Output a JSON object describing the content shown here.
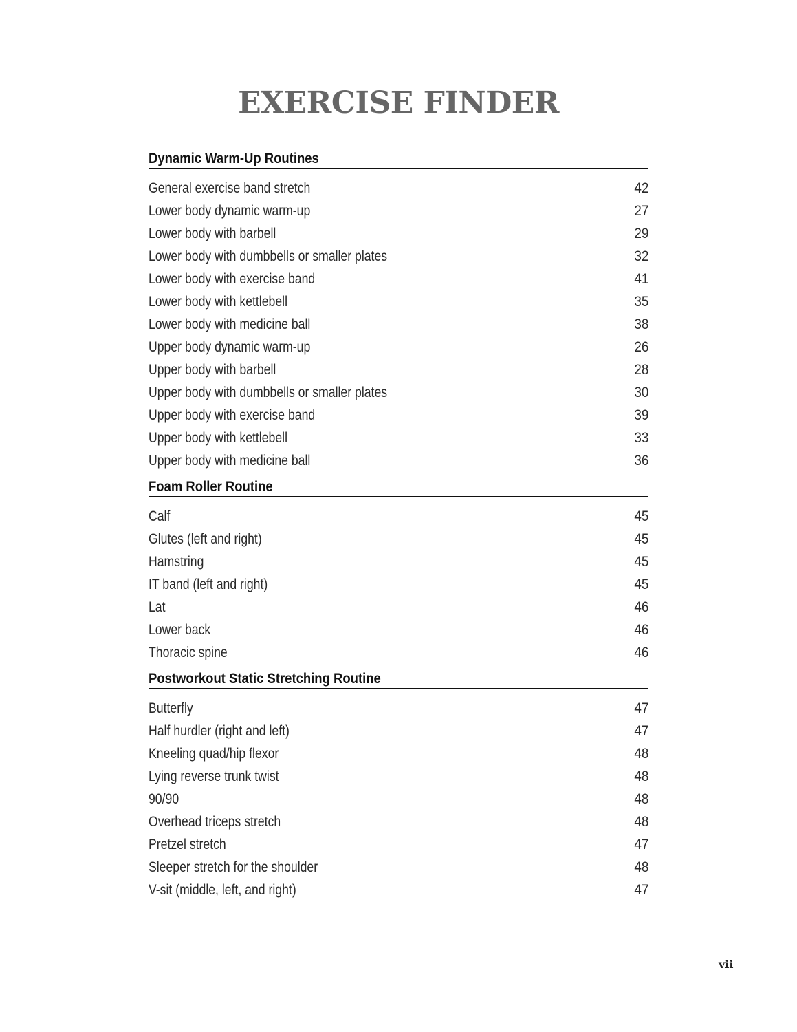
{
  "title": "EXERCISE FINDER",
  "page_number": "vii",
  "sections": [
    {
      "heading": "Dynamic Warm-Up Routines",
      "entries": [
        {
          "name": "General exercise band stretch",
          "page": "42"
        },
        {
          "name": "Lower body dynamic warm-up",
          "page": "27"
        },
        {
          "name": "Lower body with barbell",
          "page": "29"
        },
        {
          "name": "Lower body with dumbbells or smaller plates",
          "page": "32"
        },
        {
          "name": "Lower body with exercise band",
          "page": "41"
        },
        {
          "name": "Lower body with kettlebell",
          "page": "35"
        },
        {
          "name": "Lower body with medicine ball",
          "page": "38"
        },
        {
          "name": "Upper body dynamic warm-up",
          "page": "26"
        },
        {
          "name": "Upper body with barbell",
          "page": "28"
        },
        {
          "name": "Upper body with dumbbells or smaller plates",
          "page": "30"
        },
        {
          "name": "Upper body with exercise band",
          "page": "39"
        },
        {
          "name": "Upper body with kettlebell",
          "page": "33"
        },
        {
          "name": "Upper body with medicine ball",
          "page": "36"
        }
      ]
    },
    {
      "heading": "Foam Roller Routine",
      "entries": [
        {
          "name": "Calf",
          "page": "45"
        },
        {
          "name": "Glutes (left and right)",
          "page": "45"
        },
        {
          "name": "Hamstring",
          "page": "45"
        },
        {
          "name": "IT band (left and right)",
          "page": "45"
        },
        {
          "name": "Lat",
          "page": "46"
        },
        {
          "name": "Lower back",
          "page": "46"
        },
        {
          "name": "Thoracic spine",
          "page": "46"
        }
      ]
    },
    {
      "heading": "Postworkout Static Stretching Routine",
      "entries": [
        {
          "name": "Butterfly",
          "page": "47"
        },
        {
          "name": "Half hurdler (right and left)",
          "page": "47"
        },
        {
          "name": "Kneeling quad/hip flexor",
          "page": "48"
        },
        {
          "name": "Lying reverse trunk twist",
          "page": "48"
        },
        {
          "name": "90/90",
          "page": "48"
        },
        {
          "name": "Overhead triceps stretch",
          "page": "48"
        },
        {
          "name": "Pretzel stretch",
          "page": "47"
        },
        {
          "name": "Sleeper stretch for the shoulder",
          "page": "48"
        },
        {
          "name": "V-sit (middle, left, and right)",
          "page": "47"
        }
      ]
    }
  ]
}
